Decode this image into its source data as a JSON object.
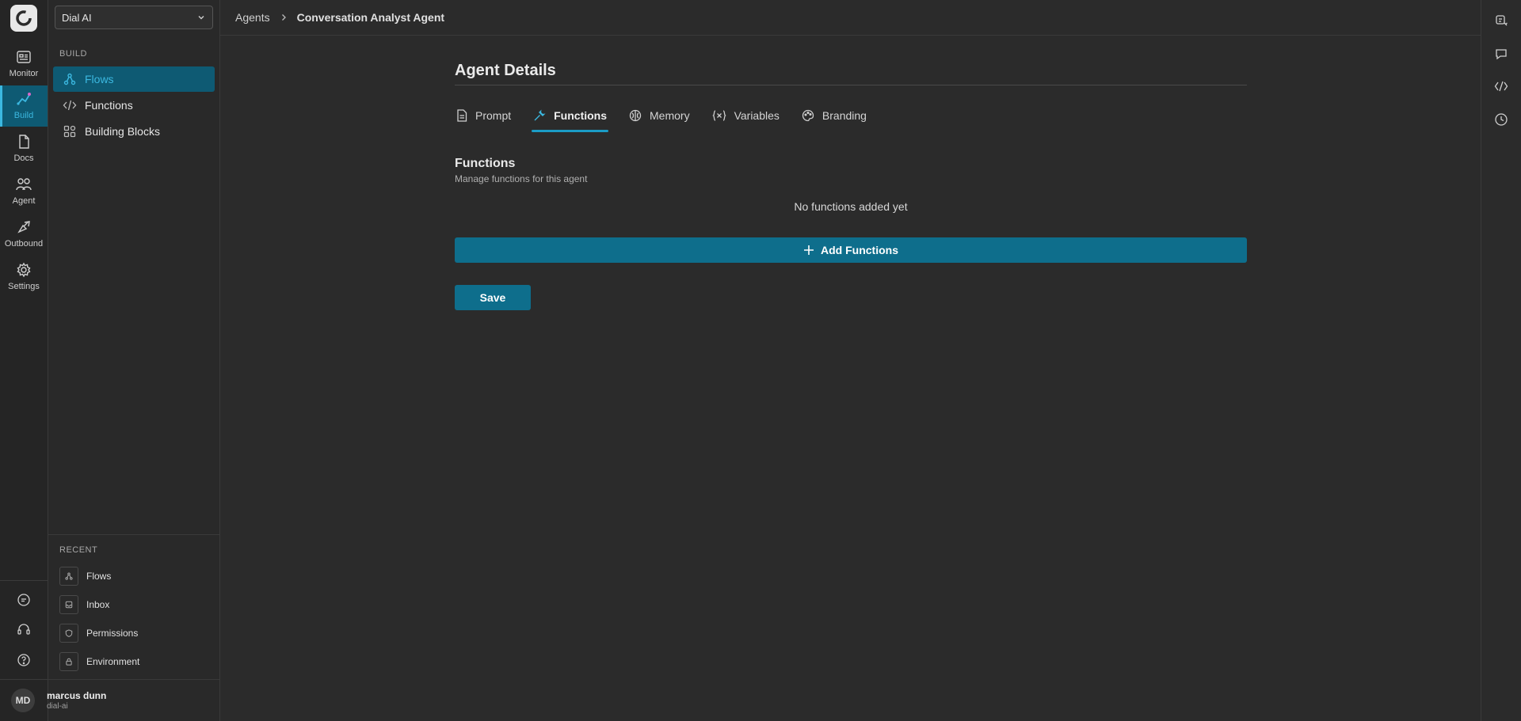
{
  "rail": {
    "items": [
      {
        "label": "Monitor",
        "icon": "monitor-icon"
      },
      {
        "label": "Build",
        "icon": "build-icon",
        "active": true
      },
      {
        "label": "Docs",
        "icon": "docs-icon"
      },
      {
        "label": "Agent",
        "icon": "agent-icon"
      },
      {
        "label": "Outbound",
        "icon": "outbound-icon"
      },
      {
        "label": "Settings",
        "icon": "settings-icon"
      }
    ],
    "bottom_icons": [
      "chat-icon",
      "support-icon",
      "help-icon"
    ]
  },
  "sidebar": {
    "workspace": "Dial AI",
    "build_label": "BUILD",
    "items": [
      {
        "label": "Flows",
        "icon": "flows-icon",
        "active": true
      },
      {
        "label": "Functions",
        "icon": "code-icon"
      },
      {
        "label": "Building Blocks",
        "icon": "blocks-icon"
      }
    ],
    "recent_label": "RECENT",
    "recent": [
      {
        "label": "Flows",
        "icon": "flows-icon"
      },
      {
        "label": "Inbox",
        "icon": "inbox-icon"
      },
      {
        "label": "Permissions",
        "icon": "shield-icon"
      },
      {
        "label": "Environment",
        "icon": "lock-icon"
      }
    ]
  },
  "user": {
    "initials": "MD",
    "name": "marcus dunn",
    "org": "dial-ai"
  },
  "breadcrumb": {
    "parent": "Agents",
    "current": "Conversation Analyst Agent"
  },
  "main": {
    "title": "Agent Details",
    "tabs": [
      {
        "label": "Prompt",
        "icon": "document-icon"
      },
      {
        "label": "Functions",
        "icon": "wrench-icon",
        "active": true
      },
      {
        "label": "Memory",
        "icon": "brain-icon"
      },
      {
        "label": "Variables",
        "icon": "variables-icon"
      },
      {
        "label": "Branding",
        "icon": "palette-icon"
      }
    ],
    "section_title": "Functions",
    "section_subtitle": "Manage functions for this agent",
    "empty_text": "No functions added yet",
    "add_label": "Add Functions",
    "save_label": "Save"
  },
  "colors": {
    "accent": "#0e6e8c",
    "accent_text": "#3bb8e0",
    "background": "#2b2b2b"
  }
}
